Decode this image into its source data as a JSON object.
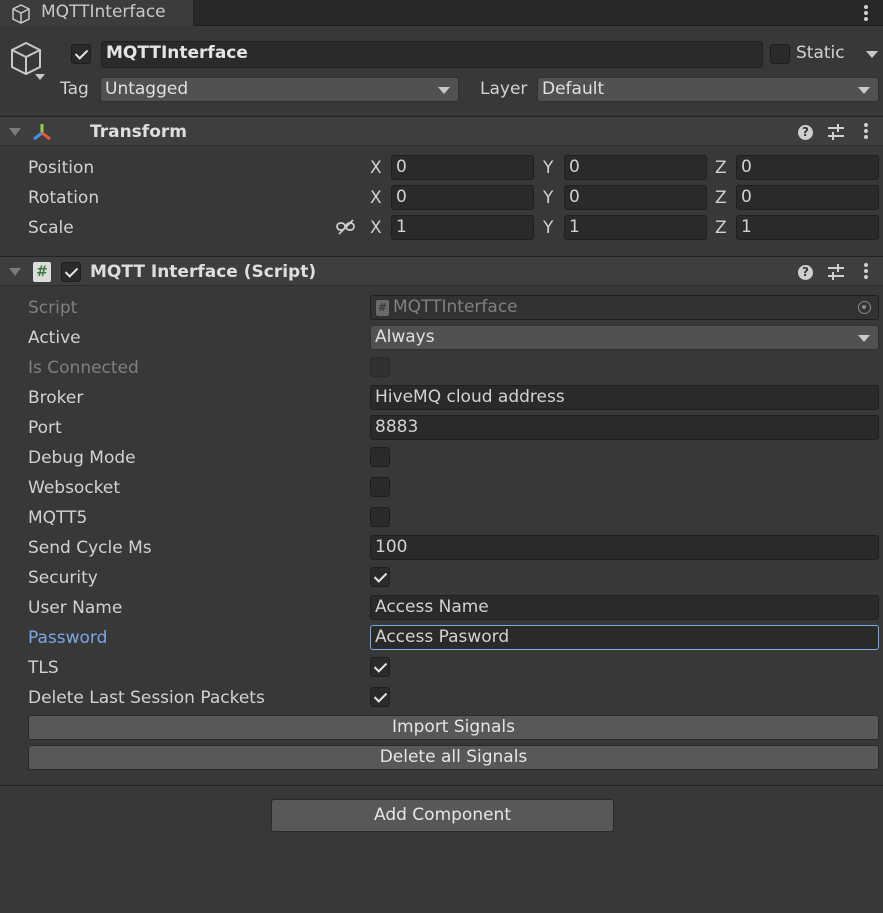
{
  "tab": {
    "title": "MQTTInterface"
  },
  "header": {
    "object_name": "MQTTInterface",
    "active_checked": true,
    "static_label": "Static",
    "tag_label": "Tag",
    "tag_value": "Untagged",
    "layer_label": "Layer",
    "layer_value": "Default"
  },
  "transform": {
    "title": "Transform",
    "rows": [
      {
        "label": "Position",
        "x": "0",
        "y": "0",
        "z": "0"
      },
      {
        "label": "Rotation",
        "x": "0",
        "y": "0",
        "z": "0"
      },
      {
        "label": "Scale",
        "x": "1",
        "y": "1",
        "z": "1"
      }
    ],
    "axes": {
      "x": "X",
      "y": "Y",
      "z": "Z"
    }
  },
  "script_component": {
    "title": "MQTT Interface (Script)",
    "enabled": true,
    "fields": {
      "script_label": "Script",
      "script_value": "MQTTInterface",
      "active_label": "Active",
      "active_value": "Always",
      "is_connected_label": "Is Connected",
      "broker_label": "Broker",
      "broker_value": "HiveMQ cloud address",
      "port_label": "Port",
      "port_value": "8883",
      "debug_label": "Debug Mode",
      "websocket_label": "Websocket",
      "mqtt5_label": "MQTT5",
      "send_cycle_label": "Send Cycle Ms",
      "send_cycle_value": "100",
      "security_label": "Security",
      "username_label": "User Name",
      "username_value": "Access Name",
      "password_label": "Password",
      "password_value": "Access Pasword",
      "tls_label": "TLS",
      "delete_last_label": "Delete Last Session Packets"
    },
    "checks": {
      "is_connected": false,
      "debug_mode": false,
      "websocket": false,
      "mqtt5": false,
      "security": true,
      "tls": true,
      "delete_last_session": true
    },
    "import_button": "Import Signals",
    "delete_button": "Delete all Signals"
  },
  "add_component_button": "Add Component",
  "colors": {
    "background": "#383838",
    "field": "#2a2a2a",
    "focus": "#7aa7e6",
    "button": "#585858"
  },
  "icons": {
    "tab": "cube-icon",
    "object": "cube-icon",
    "transform": "transform-axes-icon",
    "script": "csharp-script-icon",
    "help": "help-icon",
    "presets": "sliders-icon",
    "menu": "kebab-menu-icon",
    "link": "constrain-proportions-icon",
    "target": "object-picker-icon"
  }
}
